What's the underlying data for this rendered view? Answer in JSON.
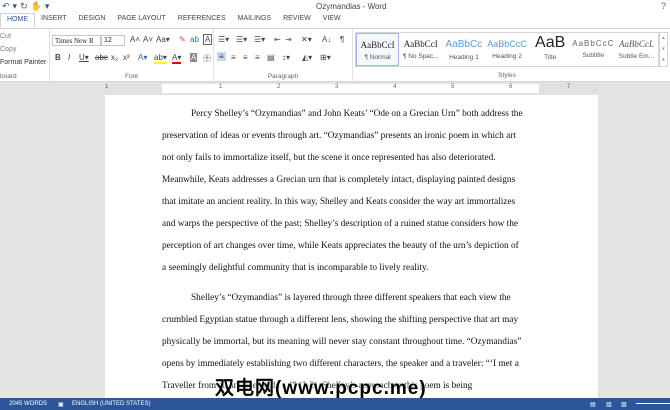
{
  "window": {
    "title": "Ozymandias - Word",
    "help": "?"
  },
  "qat": {
    "undo": "↶",
    "redo": "↻",
    "touch": "✋"
  },
  "tabs": [
    "HOME",
    "INSERT",
    "DESIGN",
    "PAGE LAYOUT",
    "REFERENCES",
    "MAILINGS",
    "REVIEW",
    "VIEW"
  ],
  "clipboard": {
    "cut": "Cut",
    "copy": "Copy",
    "format_painter": "Format Painter",
    "label": "board"
  },
  "font": {
    "name": "Times New R",
    "size": "12",
    "label": "Font"
  },
  "paragraph": {
    "label": "Paragraph"
  },
  "styles": {
    "label": "Styles",
    "items": [
      {
        "preview": "AaBbCcI",
        "name": "¶ Normal"
      },
      {
        "preview": "AaBbCcI",
        "name": "¶ No Spac..."
      },
      {
        "preview": "AaBbCc",
        "name": "Heading 1"
      },
      {
        "preview": "AaBbCcC",
        "name": "Heading 2"
      },
      {
        "preview": "AaB",
        "name": "Title"
      },
      {
        "preview": "AaBbCcC",
        "name": "Subtitle"
      },
      {
        "preview": "AaBbCcL",
        "name": "Subtle Em..."
      }
    ]
  },
  "ruler": [
    "1",
    "1",
    "2",
    "3",
    "4",
    "5",
    "6",
    "7"
  ],
  "document": {
    "lines": [
      "Percy Shelley’s “Ozymandias” and John Keats’ “Ode on a Grecian Urn” both address the",
      "preservation of ideas or events through art. “Ozymandias” presents an ironic poem in which art",
      "not only fails to immortalize itself, but the scene it once represented has also deteriorated.",
      "Meanwhile, Keats addresses a Grecian urn that is completely intact, displaying painted designs",
      "that imitate an ancient reality. In this way, Shelley and Keats consider the way art immortalizes",
      "and warps the perspective of the past; Shelley’s description of a ruined statue considers how the",
      "perception of art changes over time, while Keats appreciates the beauty of the urn’s depiction of",
      "a seemingly delightful community that is incomparable to lively reality.",
      "Shelley’s “Ozymandias” is layered through three different speakers that each view the",
      "crumbled Egyptian statue through a different lens, showing the shifting perspective that art may",
      "physically be immortal, but its meaning will never stay constant throughout time. “Ozymandias”",
      "opens by immediately establishing two different characters, the speaker and a traveler: “‘I met a",
      "Traveller from an antique land . . .’” (1-2). Shelley’s approach to this poem is being"
    ]
  },
  "watermark": "双电网(www.pcpc.me)",
  "status": {
    "words": "2045 WORDS",
    "language": "ENGLISH (UNITED STATES)"
  },
  "colors": {
    "accent": "#2b579a"
  }
}
